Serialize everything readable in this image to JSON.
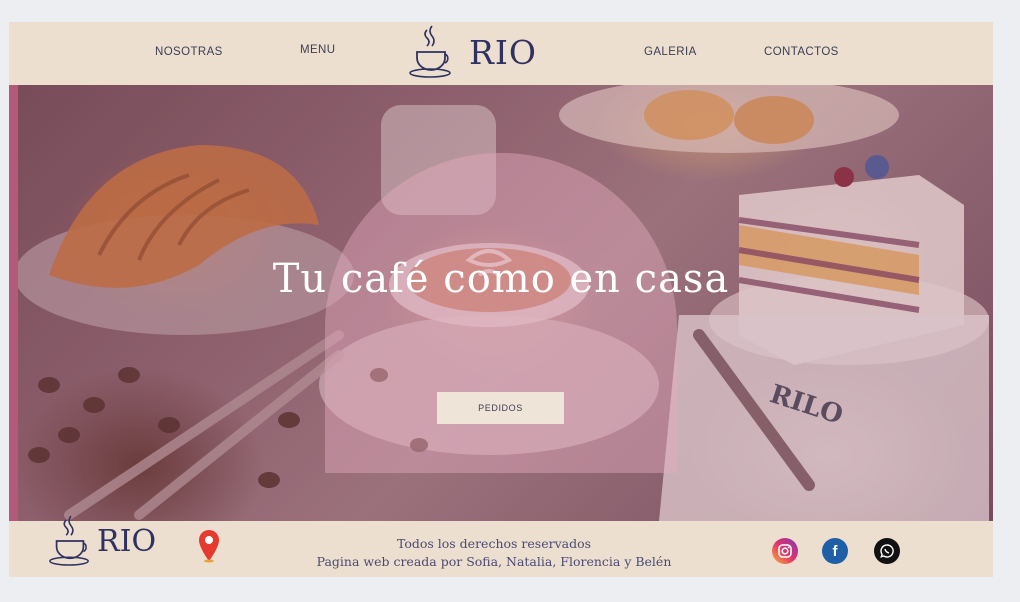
{
  "header": {
    "nav_left": [
      "NOSOTRAS",
      "MENU"
    ],
    "nav_right": [
      "GALERIA",
      "CONTACTOS"
    ],
    "logo_text": "RIO"
  },
  "hero": {
    "title": "Tu café como en casa",
    "button_label": "PEDIDOS",
    "napkin_text": "RILO"
  },
  "footer": {
    "logo_text": "RIO",
    "line1": "Todos los derechos reservados",
    "line2": "Pagina web creada por Sofia, Natalia, Florencia y Belén",
    "social": [
      {
        "icon": "instagram-icon",
        "color": "#d6336c"
      },
      {
        "icon": "facebook-icon",
        "color": "#1f5fa8"
      },
      {
        "icon": "whatsapp-icon",
        "color": "#111111"
      }
    ]
  },
  "colors": {
    "header_bg": "#ecdfd0",
    "brand_navy": "#2f3260",
    "accent_pink": "#b35a7b"
  }
}
